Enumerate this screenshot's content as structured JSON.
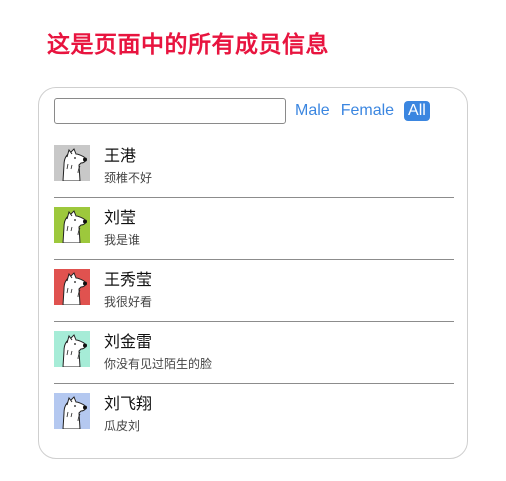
{
  "page": {
    "title": "这是页面中的所有成员信息"
  },
  "search": {
    "value": "",
    "placeholder": ""
  },
  "filters": [
    {
      "label": "Male",
      "active": false
    },
    {
      "label": "Female",
      "active": false
    },
    {
      "label": "All",
      "active": true
    }
  ],
  "colors": {
    "title": "#e8143f",
    "accent": "#3b86e0"
  },
  "members": [
    {
      "name": "王港",
      "desc": "颈椎不好",
      "avatar_icon": "dog-avatar-icon",
      "avatar_color": "#c8c8c8"
    },
    {
      "name": "刘莹",
      "desc": "我是谁",
      "avatar_icon": "dog-avatar-icon",
      "avatar_color": "#9dc83c"
    },
    {
      "name": "王秀莹",
      "desc": "我很好看",
      "avatar_icon": "dog-avatar-icon",
      "avatar_color": "#e0524f"
    },
    {
      "name": "刘金雷",
      "desc": "你没有见过陌生的脸",
      "avatar_icon": "dog-avatar-icon",
      "avatar_color": "#a6ecd7"
    },
    {
      "name": "刘飞翔",
      "desc": "瓜皮刘",
      "avatar_icon": "dog-avatar-icon",
      "avatar_color": "#b4c8f0"
    }
  ]
}
